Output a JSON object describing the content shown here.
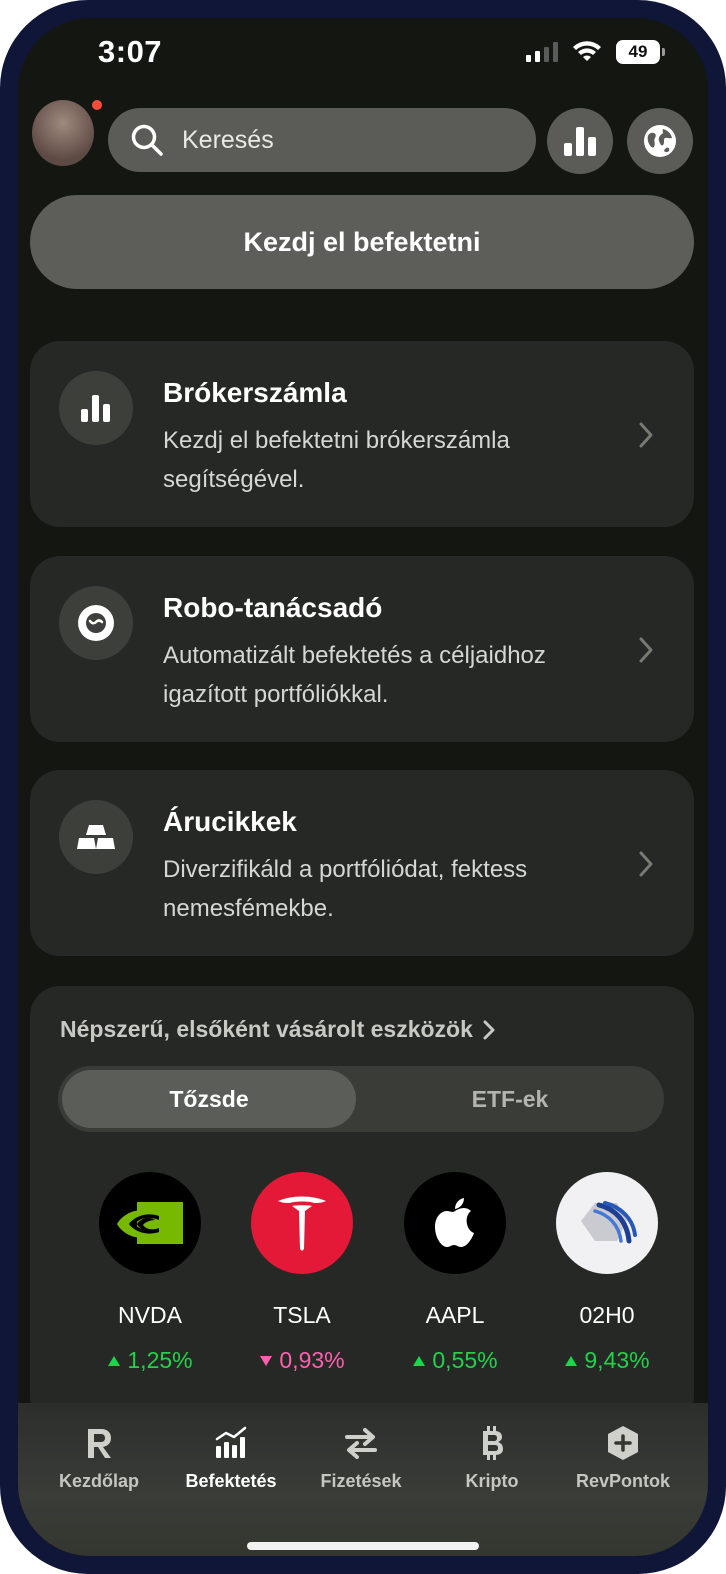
{
  "status_bar": {
    "time": "3:07",
    "battery": "49"
  },
  "header": {
    "search_placeholder": "Keresés"
  },
  "main": {
    "start_button": "Kezdj el befektetni",
    "cards": [
      {
        "title": "Brókerszámla",
        "desc": "Kezdj el befektetni brókerszámla segítségével.",
        "icon": "bar-chart-icon"
      },
      {
        "title": "Robo-tanácsadó",
        "desc": "Automatizált befektetés a céljaidhoz igazított portfóliókkal.",
        "icon": "robo-advisor-icon"
      },
      {
        "title": "Árucikkek",
        "desc": "Diverzifikáld a portfóliódat, fektess nemesfémekbe.",
        "icon": "gold-bars-icon"
      }
    ],
    "popular": {
      "title": "Népszerű, elsőként vásárolt eszközök",
      "tabs": [
        "Tőzsde",
        "ETF-ek"
      ],
      "active_tab": "Tőzsde",
      "stocks": [
        {
          "ticker": "NVDA",
          "change": "1,25%",
          "direction": "up"
        },
        {
          "ticker": "TSLA",
          "change": "0,93%",
          "direction": "down"
        },
        {
          "ticker": "AAPL",
          "change": "0,55%",
          "direction": "up"
        },
        {
          "ticker": "02H0",
          "change": "9,43%",
          "direction": "up"
        }
      ]
    }
  },
  "bottom_nav": {
    "items": [
      "Kezdőlap",
      "Befektetés",
      "Fizetések",
      "Kripto",
      "RevPontok"
    ],
    "active": "Befektetés"
  },
  "colors": {
    "up": "#22d34a",
    "down": "#ff5fb0",
    "background": "#141612",
    "card": "#262825"
  }
}
